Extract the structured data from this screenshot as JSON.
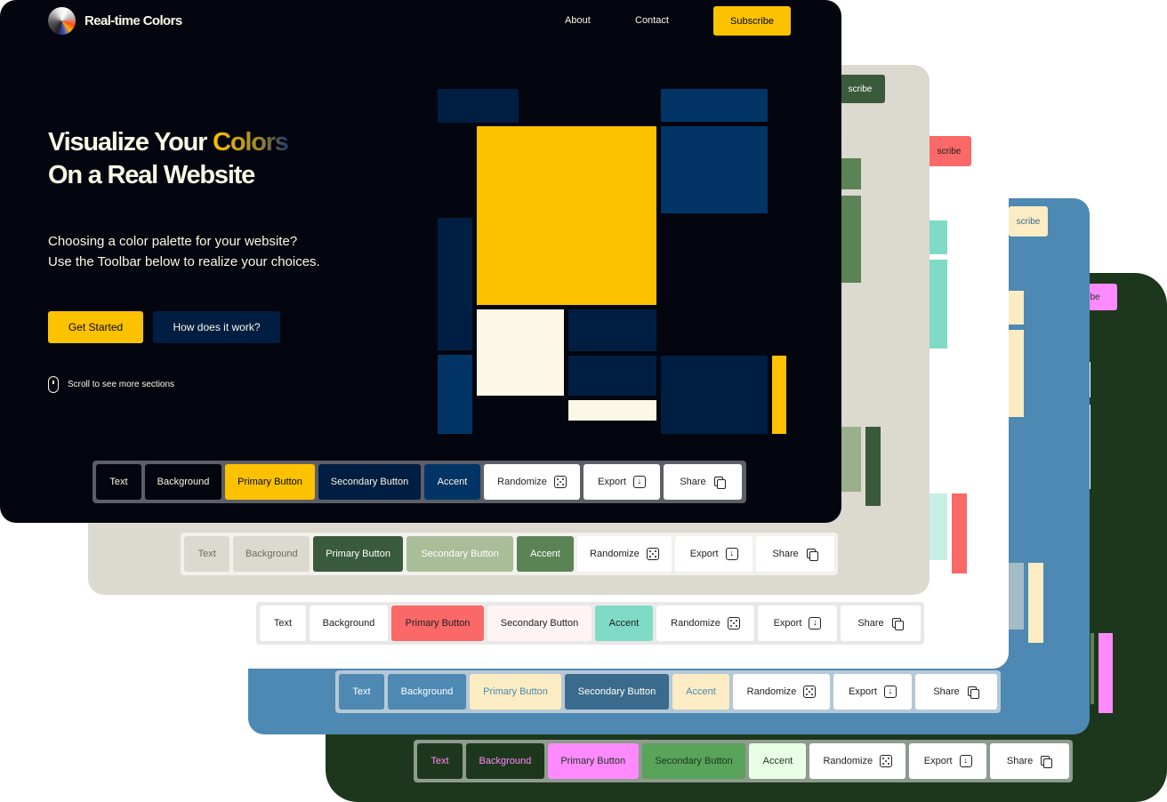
{
  "brand": {
    "name": "Real-time Colors"
  },
  "nav": {
    "about": "About",
    "contact": "Contact",
    "subscribe": "Subscribe"
  },
  "hero": {
    "title_part1": "Visualize Your ",
    "title_accent": "Colors",
    "title_line2": "On a Real Website",
    "desc_line1": "Choosing a color palette for your website?",
    "desc_line2": "Use the Toolbar below to realize your choices.",
    "cta_primary": "Get Started",
    "cta_secondary": "How does it work?",
    "scroll_hint": "Scroll to see more sections"
  },
  "fragments": {
    "subscribe_tail": "scribe",
    "subscribe_tail_short": "be"
  },
  "toolbar_labels": {
    "text": "Text",
    "background": "Background",
    "primary": "Primary Button",
    "secondary": "Secondary Button",
    "accent": "Accent",
    "randomize": "Randomize",
    "export": "Export",
    "share": "Share"
  },
  "palettes": [
    {
      "name": "dark-navy",
      "text": "#fbf8e6",
      "background": "#03060f",
      "primary": "#fcc200",
      "secondary": "#001e42",
      "accent": "#023466"
    },
    {
      "name": "beige-green",
      "text": "#6c6b64",
      "background": "#dcd9d0",
      "primary": "#3a5a3c",
      "secondary": "#a8bd98",
      "accent": "#5b8456"
    },
    {
      "name": "white-coral",
      "text": "#202020",
      "background": "#ffffff",
      "primary": "#fa6868",
      "secondary": "#fef4f4",
      "accent": "#7fdbc5"
    },
    {
      "name": "steel-blue",
      "text": "#ffffff",
      "background": "#4d89b2",
      "primary": "#fbecc3",
      "secondary": "#3b6b8c",
      "accent": "#fbecc3"
    },
    {
      "name": "forest-pink",
      "text": "#ff89ff",
      "background": "#1d371c",
      "primary": "#ff89ff",
      "secondary": "#59a35b",
      "accent": "#e9ffe6"
    }
  ],
  "icons": [
    "logo-icon",
    "mouse-icon",
    "dice-icon",
    "download-icon",
    "copy-icon"
  ]
}
